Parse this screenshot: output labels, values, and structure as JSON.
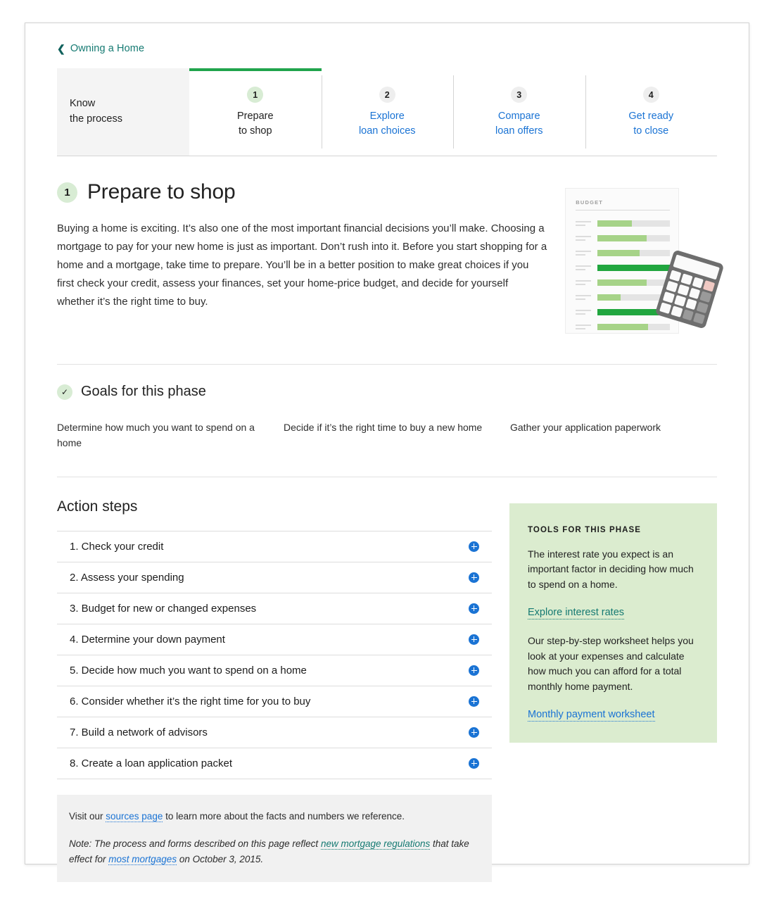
{
  "breadcrumb": {
    "label": "Owning a Home",
    "icon": "chevron-left-icon"
  },
  "tabs": [
    {
      "num": "",
      "line1": "Know",
      "line2": "the process",
      "active": false
    },
    {
      "num": "1",
      "line1": "Prepare",
      "line2": "to shop",
      "active": true
    },
    {
      "num": "2",
      "line1": "Explore",
      "line2": "loan choices",
      "active": false
    },
    {
      "num": "3",
      "line1": "Compare",
      "line2": "loan offers",
      "active": false
    },
    {
      "num": "4",
      "line1": "Get ready",
      "line2": "to close",
      "active": false
    }
  ],
  "hero": {
    "badge": "1",
    "title": "Prepare to shop",
    "body": "Buying a home is exciting. It’s also one of the most important financial decisions you’ll make. Choosing a mortgage to pay for your new home is just as important. Don’t rush into it. Before you start shopping for a home and a mortgage, take time to prepare. You’ll be in a better position to make great choices if you first check your credit, assess your finances, set your home-price budget, and decide for yourself whether it’s the right time to buy."
  },
  "illustration": {
    "sheet_title": "BUDGET",
    "bars": [
      {
        "percent": 47,
        "dark": false
      },
      {
        "percent": 68,
        "dark": false
      },
      {
        "percent": 58,
        "dark": false
      },
      {
        "percent": 100,
        "dark": true
      },
      {
        "percent": 68,
        "dark": false
      },
      {
        "percent": 32,
        "dark": false
      },
      {
        "percent": 100,
        "dark": true
      },
      {
        "percent": 70,
        "dark": false
      }
    ]
  },
  "goals": {
    "icon": "check-icon",
    "title": "Goals for this phase",
    "items": [
      "Determine how much you want to spend on a home",
      "Decide if it’s the right time to buy a new home",
      "Gather your application paperwork"
    ]
  },
  "action_steps": {
    "title": "Action steps",
    "items": [
      "1. Check your credit",
      "2. Assess your spending",
      "3. Budget for new or changed expenses",
      "4. Determine your down payment",
      "5. Decide how much you want to spend on a home",
      "6. Consider whether it’s the right time for you to buy",
      "7. Build a network of advisors",
      "8. Create a loan application packet"
    ],
    "expand_icon": "plus-circle-icon"
  },
  "tools": {
    "heading": "TOOLS FOR THIS PHASE",
    "paragraph1": "The interest rate you expect is an important factor in deciding how much to spend on a home.",
    "link1": "Explore interest rates",
    "paragraph2": "Our step-by-step worksheet helps you look at your expenses and calculate how much you can afford for a total monthly home payment.",
    "link2": "Monthly payment worksheet"
  },
  "footer": {
    "line1_before": "Visit our ",
    "line1_link": "sources page",
    "line1_after": " to learn more about the facts and numbers we reference.",
    "note_before": "Note: The process and forms described on this page reflect ",
    "note_link1": "new mortgage regulations",
    "note_middle": " that take effect for ",
    "note_link2": "most mortgages",
    "note_after": " on October 3, 2015."
  },
  "colors": {
    "accent_green": "#20a44c",
    "badge_green": "#d8ecd4",
    "link_blue": "#1a73d4",
    "link_teal": "#157a72",
    "panel_green": "#dbeccf"
  }
}
